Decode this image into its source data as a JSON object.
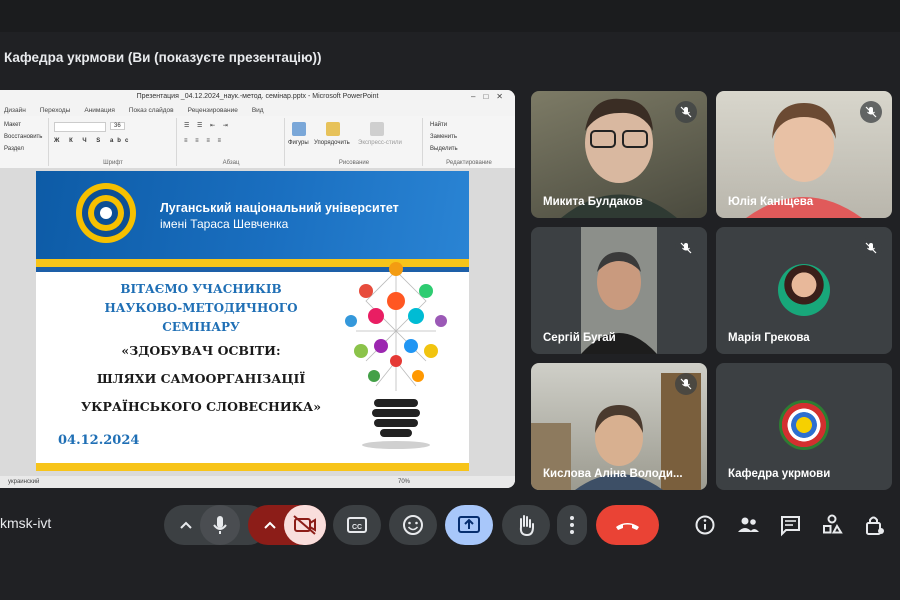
{
  "meeting": {
    "presenter_title": "Кафедра укрмови (Ви (показуєте презентацію))",
    "meeting_code": "kmsk-ivt"
  },
  "powerpoint": {
    "window_title": "Презентация _04.12.2024_наук.-метод. семінар.pptx - Microsoft PowerPoint",
    "tabs": [
      "Дизайн",
      "Переходы",
      "Анимация",
      "Показ слайдов",
      "Рецензирование",
      "Вид"
    ],
    "ribbon": {
      "layout_label": "Макет",
      "reset_label": "Восстановить",
      "section_label": "Раздел",
      "font_size": "36",
      "font_group": "Шрифт",
      "paragraph_group": "Абзац",
      "figures_label": "Фигуры",
      "arrange_label": "Упорядочить",
      "quick_styles_label": "Экспресс-стили",
      "drawing_group": "Рисование",
      "find_label": "Найти",
      "replace_label": "Заменить",
      "select_label": "Выделить",
      "editing_group": "Редактирование"
    },
    "status_language": "украинский",
    "zoom": "70%"
  },
  "slide": {
    "university_name": "Луганський національний університет",
    "university_sub": "імені Тараса Шевченка",
    "line1": "ВІТАЄМО УЧАСНИКІВ",
    "line2": "НАУКОВО-МЕТОДИЧНОГО",
    "line3": "СЕМІНАРУ",
    "line4": "«ЗДОБУВАЧ ОСВІТИ:",
    "line5": "ШЛЯХИ САМООРГАНІЗАЦІЇ",
    "line6": "УКРАЇНСЬКОГО СЛОВЕСНИКА»",
    "date": "04.12.2024"
  },
  "participants": [
    {
      "name": "Микита Булдаков",
      "muted": true
    },
    {
      "name": "Юлія Каніщева",
      "muted": true
    },
    {
      "name": "Сергій Бугай",
      "muted": true
    },
    {
      "name": "Марія Грекова",
      "muted": true
    },
    {
      "name": "Кислова Аліна Володи...",
      "muted": true
    },
    {
      "name": "Кафедра укрмови",
      "muted": false
    }
  ],
  "controls": {
    "more_options_chevron": "chevron-up-icon",
    "mic": "mic-icon",
    "camera_off": "camera-off-icon",
    "captions": "captions-icon",
    "emoji": "emoji-icon",
    "present": "present-icon",
    "raise_hand": "hand-icon",
    "more": "more-vert-icon",
    "leave": "leave-call-icon",
    "info": "info-icon",
    "people": "people-icon",
    "chat": "chat-icon",
    "activities": "activities-icon",
    "host_controls": "lock-person-icon"
  },
  "colors": {
    "background": "#202124",
    "tile": "#3c4043",
    "leave": "#ea4335",
    "camera_off_bg": "#f9dedc",
    "camera_off_arrow_bg": "#8c1d18",
    "present_bg": "#a8c7fa",
    "slide_blue": "#1f6fb5",
    "slide_yellow": "#f7c41a"
  }
}
